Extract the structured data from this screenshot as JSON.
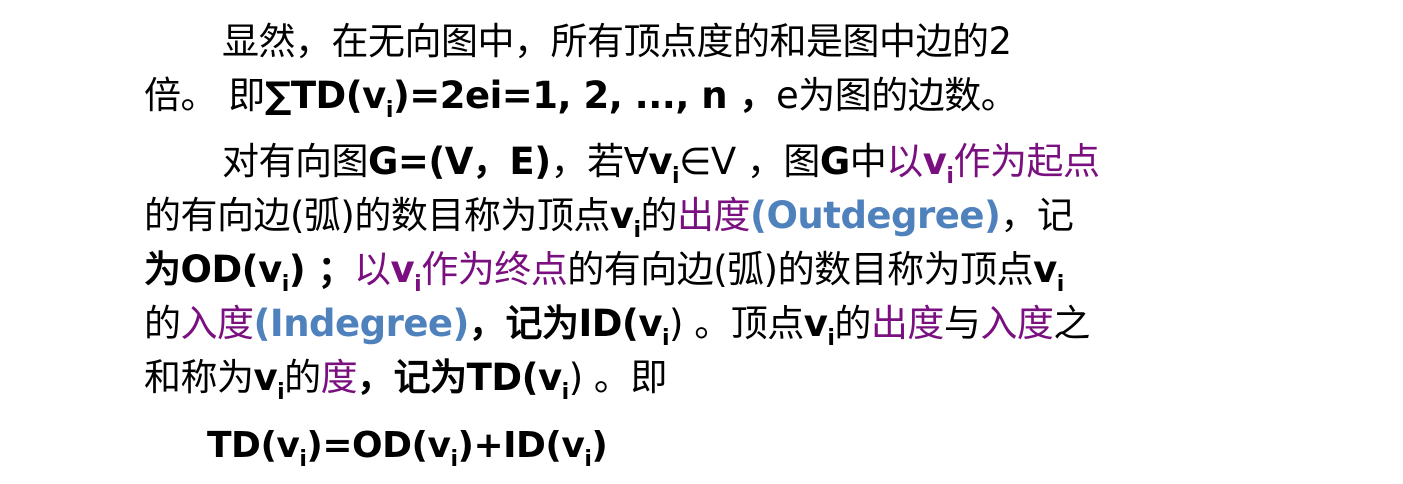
{
  "para1": {
    "line1": "显然，在无向图中，所有顶点度的和是图中边的2",
    "line2_prefix": "倍。 即",
    "formula_a": "∑TD(v",
    "i": "i",
    "formula_b": ")=2e",
    "range": "i=1, 2, ..., n ，",
    "suffix": "e为图的边数。"
  },
  "para2": {
    "l1_a": "对有向图",
    "l1_g": "G=(V，E)",
    "l1_b": "，若∀",
    "v": "v",
    "i": "i",
    "l1_c": "∈V ，图",
    "l1_g2": "G",
    "l1_d": "中",
    "l1_e": "以",
    "l1_f": "作为起点",
    "l2_a": "的有向边(弧)的数目称为顶点",
    "l2_b": "的",
    "out_term": "出度",
    "paren_open": "(",
    "outdegree": "Outdegree",
    "paren_close": ")",
    "l2_c": "，记",
    "l3_a": "为OD(",
    "l3_b": ") ；",
    "l3_c": "以",
    "l3_d": "作为终点",
    "l3_e": "的有向边(弧)的数目称为顶点",
    "l4_a": "的",
    "in_term": "入度",
    "indegree": "Indegree",
    "l4_b": "，记为ID(",
    "l4_c": ") 。顶点",
    "l4_d": "的",
    "out_term2": "出度",
    "l4_e": "与",
    "in_term2": "入度",
    "l4_f": "之",
    "l5_a": "和称为",
    "l5_b": "的",
    "deg_term": "度",
    "l5_c": "，记为TD(",
    "l5_d": ") 。即"
  },
  "formula": {
    "a": "TD(v",
    "b": ")=OD(v",
    "c": ")+ID(v",
    "d": ")",
    "i": "i"
  },
  "colors": {
    "term": "#7a0f7f",
    "english": "#4f81bd",
    "text": "#000000"
  }
}
